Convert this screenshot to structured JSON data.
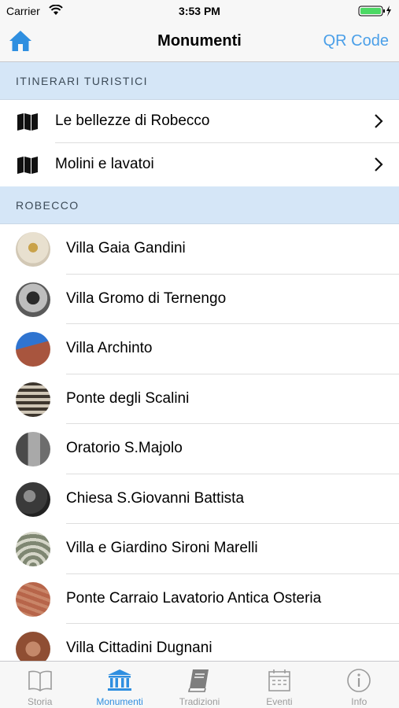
{
  "status_bar": {
    "carrier": "Carrier",
    "time": "3:53 PM"
  },
  "nav": {
    "title": "Monumenti",
    "right_button": "QR Code"
  },
  "colors": {
    "accent": "#2f8fe0",
    "section_bg": "#d5e6f7",
    "tab_inactive": "#9b9b9b"
  },
  "sections": [
    {
      "header": "ITINERARI TURISTICI",
      "items": [
        {
          "label": "Le bellezze di Robecco",
          "icon": "map-icon"
        },
        {
          "label": "Molini e lavatoi",
          "icon": "map-icon"
        }
      ]
    },
    {
      "header": "ROBECCO",
      "items": [
        {
          "label": "Villa Gaia Gandini",
          "thumb_color": "#d9d2c4"
        },
        {
          "label": "Villa Gromo di Ternengo",
          "thumb_color": "#6a6a6a"
        },
        {
          "label": "Villa Archinto",
          "thumb_color": "#3a78c9"
        },
        {
          "label": "Ponte degli Scalini",
          "thumb_color": "#5a5147"
        },
        {
          "label": "Oratorio S.Majolo",
          "thumb_color": "#7c7c7c"
        },
        {
          "label": "Chiesa S.Giovanni Battista",
          "thumb_color": "#3b3b3b"
        },
        {
          "label": "Villa e Giardino Sironi Marelli",
          "thumb_color": "#8a8f7d"
        },
        {
          "label": "Ponte Carraio Lavatorio Antica Osteria",
          "thumb_color": "#b86a4f"
        },
        {
          "label": "Villa Cittadini Dugnani",
          "thumb_color": "#9a5a3c"
        }
      ]
    }
  ],
  "tabs": [
    {
      "label": "Storia",
      "icon": "book-open-icon",
      "active": false
    },
    {
      "label": "Monumenti",
      "icon": "monument-icon",
      "active": true
    },
    {
      "label": "Tradizioni",
      "icon": "book-closed-icon",
      "active": false
    },
    {
      "label": "Eventi",
      "icon": "calendar-icon",
      "active": false
    },
    {
      "label": "Info",
      "icon": "info-icon",
      "active": false
    }
  ]
}
